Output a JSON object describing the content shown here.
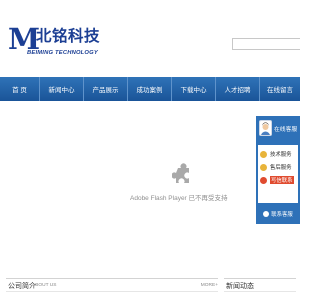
{
  "brand": {
    "logo_letter": "M",
    "name_cn": "北铭科技",
    "name_en": "BEIMING TECHNOLOGY",
    "color": "#1c3f94"
  },
  "search": {
    "placeholder": ""
  },
  "nav": {
    "color": "#1f5fa6",
    "items": [
      {
        "label": "首 页"
      },
      {
        "label": "新闻中心"
      },
      {
        "label": "产品展示"
      },
      {
        "label": "成功案例"
      },
      {
        "label": "下载中心"
      },
      {
        "label": "人才招聘"
      },
      {
        "label": "在线留言"
      }
    ]
  },
  "banner": {
    "plugin_icon": "puzzle-piece-icon",
    "message": "Adobe Flash Player 已不再受支持"
  },
  "service": {
    "title": "在线客服",
    "items": [
      {
        "label": "技术服务",
        "icon": "qq-icon",
        "color": "#e8b43a"
      },
      {
        "label": "售后服务",
        "icon": "qq-icon",
        "color": "#e8b43a"
      },
      {
        "label": "QQ",
        "icon": "qq-icon",
        "color": "#e04b2f",
        "badge": "写信联系"
      }
    ],
    "footer_label": "联系客服",
    "accent": "#2e71b8"
  },
  "sections": {
    "company": {
      "title": "公司简介",
      "subtitle": "ABOUT US",
      "more": "MORE+"
    },
    "news": {
      "title": "新闻动态"
    }
  }
}
